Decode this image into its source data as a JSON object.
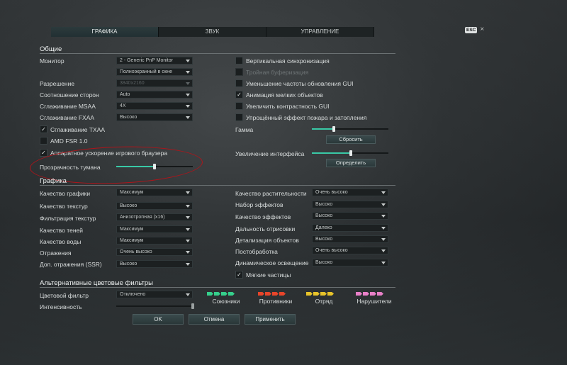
{
  "tabs": [
    "ГРАФИКА",
    "ЗВУК",
    "УПРАВЛЕНИЕ"
  ],
  "esc": {
    "key": "ESC",
    "close": "×"
  },
  "general": {
    "title": "Общие",
    "monitor": {
      "label": "Монитор",
      "value": "2 - Generic PnP Monitor"
    },
    "mode": {
      "value": "Полноэкранный в окне"
    },
    "resolution": {
      "label": "Разрешение",
      "value": "3840x2160"
    },
    "aspect": {
      "label": "Соотношение сторон",
      "value": "Auto"
    },
    "msaa": {
      "label": "Сглаживание MSAA",
      "value": "4X"
    },
    "fxaa": {
      "label": "Сглаживание FXAA",
      "value": "Высоко"
    },
    "txaa": {
      "label": "Сглаживание TXAA",
      "checked": true
    },
    "fsr": {
      "label": "AMD FSR 1.0",
      "checked": false
    },
    "browser_accel": {
      "label": "Аппаратное ускорение игрового браузера",
      "checked": true
    },
    "fog": {
      "label": "Прозрачность тумана",
      "level": 0.5
    },
    "vsync": {
      "label": "Вертикальная синхронизация",
      "checked": false
    },
    "triple": {
      "label": "Тройная буферизация",
      "checked": false
    },
    "reduce_gui": {
      "label": "Уменьшение частоты обновления GUI",
      "checked": false
    },
    "anim_small": {
      "label": "Анимация мелких объектов",
      "checked": true
    },
    "contrast_gui": {
      "label": "Увеличить контрастность GUI",
      "checked": false
    },
    "fire_effect": {
      "label": "Упрощённый эффект пожара и затопления",
      "checked": false
    },
    "gamma": {
      "label": "Гамма",
      "level": 0.29,
      "button": "Сбросить"
    },
    "ui_scale": {
      "label": "Увеличение интерфейса",
      "level": 0.51,
      "button": "Определить"
    },
    "check": "✓"
  },
  "graphics": {
    "title": "Графика",
    "left": [
      {
        "label": "Качество графики",
        "value": "Максимум"
      },
      {
        "label": "Качество текстур",
        "value": "Высоко"
      },
      {
        "label": "Фильтрация текстур",
        "value": "Анизотропная (x16)"
      },
      {
        "label": "Качество теней",
        "value": "Максимум"
      },
      {
        "label": "Качество воды",
        "value": "Максимум"
      },
      {
        "label": "Отражения",
        "value": "Очень высоко"
      },
      {
        "label": "Доп. отражения (SSR)",
        "value": "Высоко"
      }
    ],
    "right": [
      {
        "label": "Качество растительности",
        "value": "Очень высоко"
      },
      {
        "label": "Набор эффектов",
        "value": "Высоко"
      },
      {
        "label": "Качество эффектов",
        "value": "Высоко"
      },
      {
        "label": "Дальность отрисовки",
        "value": "Далеко"
      },
      {
        "label": "Детализация объектов",
        "value": "Высоко"
      },
      {
        "label": "Постобработка",
        "value": "Очень высоко"
      },
      {
        "label": "Динамическое освещение",
        "value": "Высоко"
      }
    ],
    "soft_particles": {
      "label": "Мягкие частицы",
      "checked": true
    }
  },
  "filters": {
    "title": "Альтернативные цветовые фильтры",
    "color_filter": {
      "label": "Цветовой фильтр",
      "value": "Отключено"
    },
    "intensity": {
      "label": "Интенсивность",
      "level": 1.0
    },
    "groups": [
      {
        "label": "Союзники",
        "colors": [
          "#35d08c",
          "#35d08c",
          "#35d08c",
          "#35d08c"
        ]
      },
      {
        "label": "Противники",
        "colors": [
          "#e8452a",
          "#e8452a",
          "#e8452a",
          "#e8452a"
        ]
      },
      {
        "label": "Отряд",
        "colors": [
          "#e8c32a",
          "#e8c32a",
          "#e8c32a",
          "#e8c32a"
        ]
      },
      {
        "label": "Нарушители",
        "colors": [
          "#e880c8",
          "#e880c8",
          "#e880c8",
          "#e880c8"
        ]
      }
    ]
  },
  "buttons": {
    "ok": "OK",
    "cancel": "Отмена",
    "apply": "Применить"
  },
  "colors": {
    "accent": "#39c9a6",
    "highlight": "#b0141a"
  }
}
